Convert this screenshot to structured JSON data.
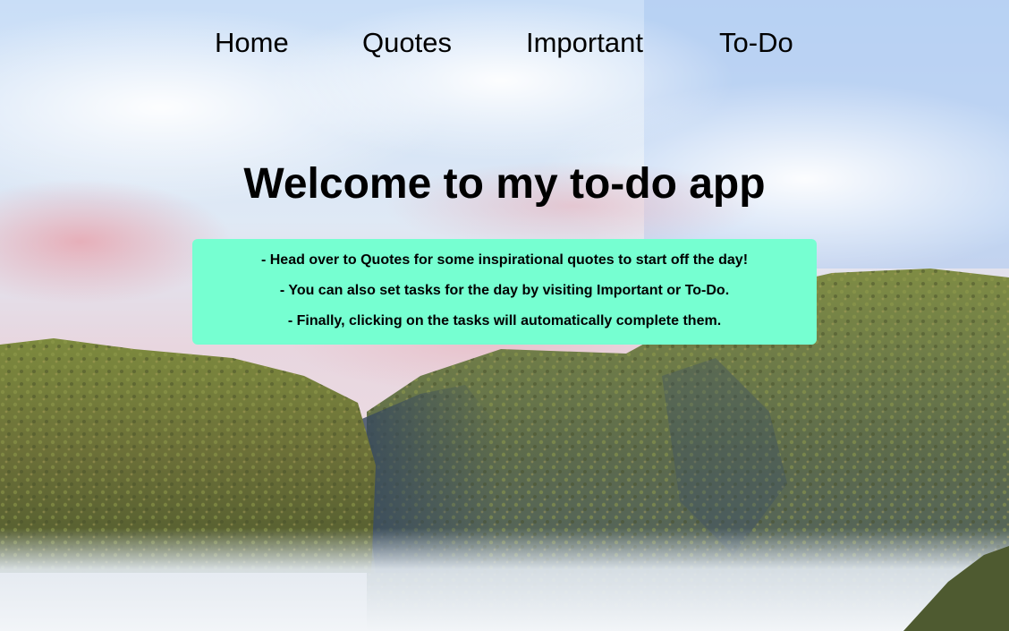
{
  "nav": {
    "items": [
      {
        "label": "Home"
      },
      {
        "label": "Quotes"
      },
      {
        "label": "Important"
      },
      {
        "label": "To-Do"
      }
    ]
  },
  "main": {
    "title": "Welcome to my to-do app",
    "info_lines": [
      "- Head over to Quotes for some inspirational quotes to start off the day!",
      "- You can also set tasks for the day by visiting Important or To-Do.",
      "- Finally, clicking on the tasks will automatically complete them."
    ]
  },
  "colors": {
    "info_box_bg": "#76ffd1",
    "text": "#000000"
  }
}
